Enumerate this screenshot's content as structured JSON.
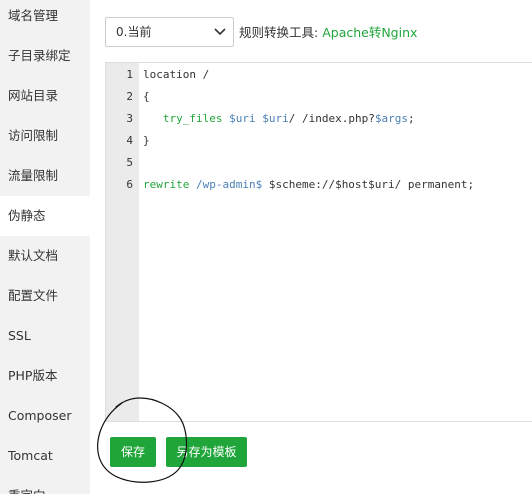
{
  "sidebar": {
    "items": [
      {
        "label": "域名管理"
      },
      {
        "label": "子目录绑定"
      },
      {
        "label": "网站目录"
      },
      {
        "label": "访问限制"
      },
      {
        "label": "流量限制"
      },
      {
        "label": "伪静态",
        "active": true
      },
      {
        "label": "默认文档"
      },
      {
        "label": "配置文件"
      },
      {
        "label": "SSL"
      },
      {
        "label": "PHP版本"
      },
      {
        "label": "Composer"
      },
      {
        "label": "Tomcat"
      },
      {
        "label": "重定向"
      }
    ]
  },
  "toolbar": {
    "select_value": "0.当前",
    "rule_tool_label": "规则转换工具:",
    "rule_tool_link": "Apache转Nginx"
  },
  "editor": {
    "line_numbers": [
      "1",
      "2",
      "3",
      "4",
      "5",
      "6"
    ],
    "lines": [
      {
        "parts": [
          {
            "t": "location /",
            "c": "default"
          }
        ]
      },
      {
        "parts": [
          {
            "t": "{",
            "c": "default"
          }
        ]
      },
      {
        "parts": [
          {
            "t": "   ",
            "c": "default"
          },
          {
            "t": "try_files",
            "c": "green"
          },
          {
            "t": " ",
            "c": "default"
          },
          {
            "t": "$uri",
            "c": "blue"
          },
          {
            "t": " ",
            "c": "default"
          },
          {
            "t": "$uri",
            "c": "blue"
          },
          {
            "t": "/ /index.php?",
            "c": "default"
          },
          {
            "t": "$args",
            "c": "blue"
          },
          {
            "t": ";",
            "c": "default"
          }
        ]
      },
      {
        "parts": [
          {
            "t": "}",
            "c": "default"
          }
        ]
      },
      {
        "parts": []
      },
      {
        "parts": [
          {
            "t": "rewrite",
            "c": "green"
          },
          {
            "t": " ",
            "c": "default"
          },
          {
            "t": "/wp-admin$",
            "c": "blue"
          },
          {
            "t": " $scheme://$host$uri/ permanent;",
            "c": "default"
          }
        ]
      }
    ]
  },
  "buttons": {
    "save_label": "保存",
    "save_template_label": "另存为模板"
  },
  "colors": {
    "accent": "#20a53a",
    "variable": "#4a7fb5",
    "sidebar_bg": "#f2f2f2",
    "gutter_bg": "#ebebeb"
  }
}
